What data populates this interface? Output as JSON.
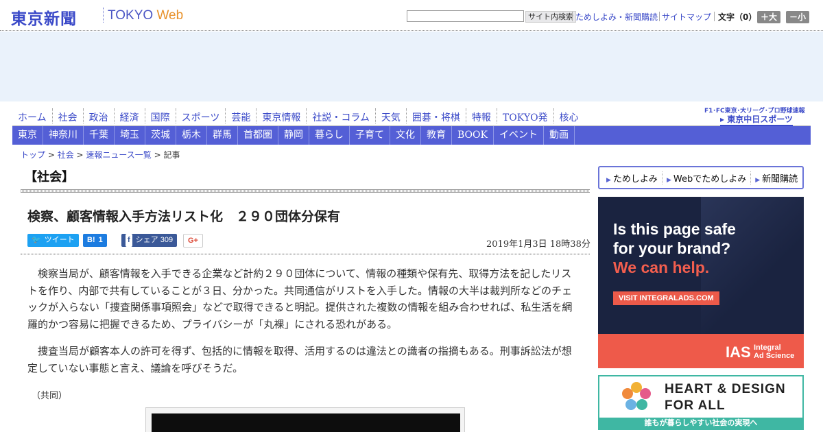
{
  "header": {
    "logo_jp": "東京新聞",
    "logo_en": "TOKYO",
    "logo_web": "Web",
    "search_button": "サイト内検索",
    "search_value": "",
    "links": [
      "ためしよみ・新聞購読",
      "サイトマップ"
    ],
    "font_size_label": "文字（0）",
    "font_larger": "＋大",
    "font_smaller": "－小"
  },
  "global_nav": {
    "items": [
      "ホーム",
      "社会",
      "政治",
      "経済",
      "国際",
      "スポーツ",
      "芸能",
      "東京情報",
      "社説・コラム",
      "天気",
      "囲碁・将棋",
      "特報",
      "TOKYO発",
      "核心"
    ]
  },
  "chunichi": {
    "top_text": "F1･FC東京･大リーグ･プロ野球速報",
    "logo": "東京中日スポーツ"
  },
  "regional_nav": {
    "items": [
      "東京",
      "神奈川",
      "千葉",
      "埼玉",
      "茨城",
      "栃木",
      "群馬",
      "首都圏",
      "静岡",
      "暮らし",
      "子育て",
      "文化",
      "教育",
      "BOOK",
      "イベント",
      "動画"
    ]
  },
  "breadcrumb": {
    "items": [
      "トップ",
      "社会",
      "速報ニュース一覧"
    ],
    "current": "記事",
    "separator": " > "
  },
  "article": {
    "section": "【社会】",
    "headline": "検察、顧客情報入手方法リスト化　２９０団体分保有",
    "date": "2019年1月3日 18時38分",
    "share": {
      "tweet": "ツイート",
      "hatena_icon": "B!",
      "hatena_count": "1",
      "facebook_icon": "f",
      "facebook_label": "シェア",
      "facebook_count": "309",
      "gplus": "G+"
    },
    "paragraphs": [
      "検察当局が、顧客情報を入手できる企業など計約２９０団体について、情報の種類や保有先、取得方法を記したリストを作り、内部で共有していることが３日、分かった。共同通信がリストを入手した。情報の大半は裁判所などのチェックが入らない「捜査関係事項照会」などで取得できると明記。提供された複数の情報を組み合わせれば、私生活を網羅的かつ容易に把握できるため、プライバシーが「丸裸」にされる恐れがある。",
      "捜査当局が顧客本人の許可を得ず、包括的に情報を取得、活用するのは違法との識者の指摘もある。刑事訴訟法が想定していない事態と言え、議論を呼びそうだ。"
    ],
    "credit": "（共同）"
  },
  "sidebar": {
    "links": [
      "ためしよみ",
      "Webでためしよみ",
      "新聞購読"
    ],
    "ad_ias": {
      "line1": "Is this page safe",
      "line2": "for your brand?",
      "line3": "We can help.",
      "cta": "VISIT INTEGRALADS.COM",
      "brand_mark": "IAS",
      "brand_name1": "Integral",
      "brand_name2": "Ad Science"
    },
    "ad_heart": {
      "line1": "HEART & DESIGN",
      "line2": "FOR ALL",
      "band": "誰もが暮らしやすい社会の実現へ"
    }
  },
  "colors": {
    "brand_blue": "#3a49c8",
    "nav_bar": "#545fd6",
    "accent_orange": "#e8912a",
    "ias_navy": "#1a2340",
    "ias_coral": "#ee5a4a",
    "teal": "#3fb7a3"
  }
}
